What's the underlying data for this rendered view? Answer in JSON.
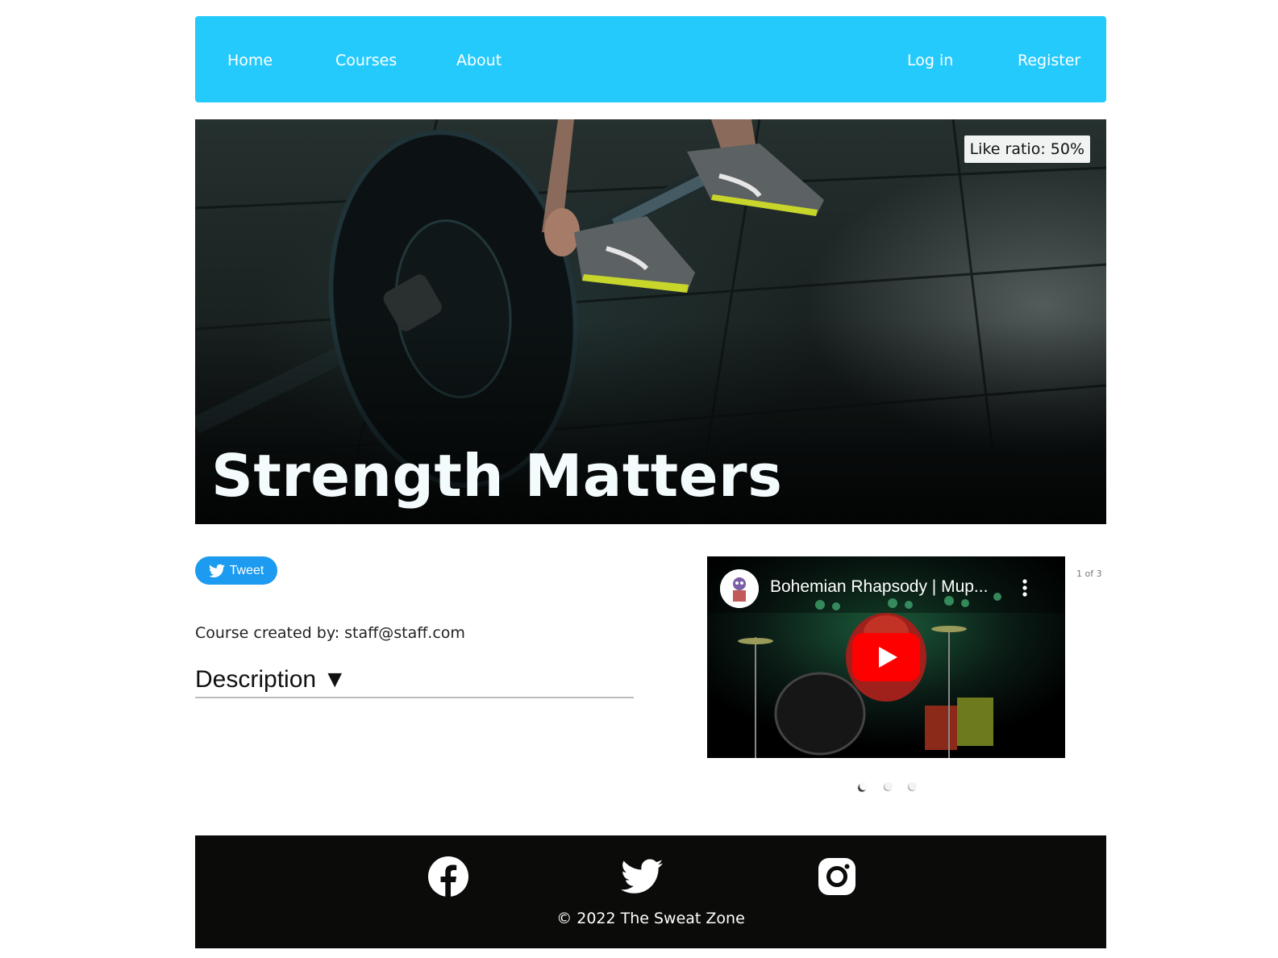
{
  "nav": {
    "home": "Home",
    "courses": "Courses",
    "about": "About",
    "login": "Log in",
    "register": "Register"
  },
  "hero": {
    "like_ratio": "Like ratio: 50%",
    "title": "Strength Matters"
  },
  "share": {
    "tweet_label": "Tweet"
  },
  "course": {
    "creator": "Course created by: staff@staff.com",
    "description_toggle": "Description ▼"
  },
  "carousel": {
    "video_title": "Bohemian Rhapsody | Mup...",
    "counter": "1 of 3",
    "active_index": 1,
    "total": 3
  },
  "footer": {
    "copyright": "© 2022 The Sweat Zone",
    "icons": [
      "facebook-icon",
      "twitter-icon",
      "instagram-icon"
    ]
  },
  "colors": {
    "nav_bg": "#25cafd",
    "tweet_bg": "#1d9bf0",
    "footer_bg": "#0b0c0a",
    "youtube_red": "#ff0000"
  }
}
